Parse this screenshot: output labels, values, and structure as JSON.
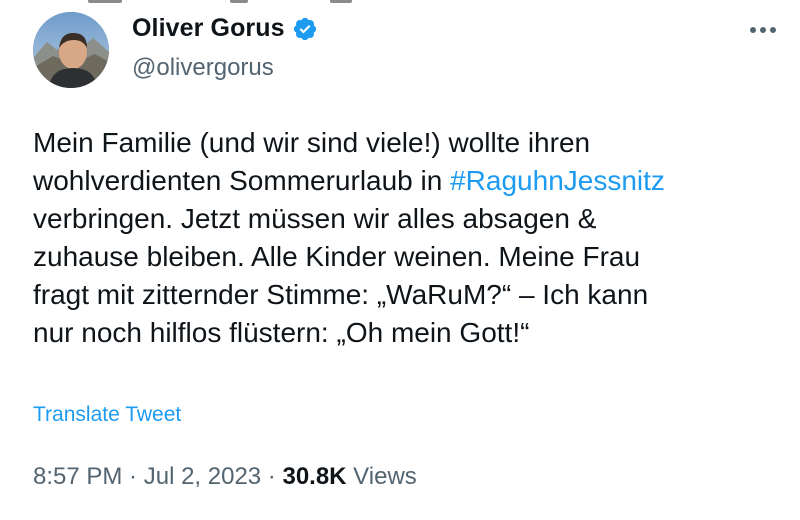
{
  "colors": {
    "text_primary": "#0f1419",
    "text_secondary": "#536471",
    "link_blue": "#1d9bf0",
    "verified_blue": "#1d9bf0"
  },
  "author": {
    "display_name": "Oliver Gorus",
    "handle": "@olivergorus",
    "verified": true,
    "avatar_icon": "profile-photo",
    "verified_icon": "verified-badge-icon"
  },
  "more_menu_icon": "more-options-icon",
  "tweet": {
    "text_before_hashtag": "Mein Familie (und wir sind viele!) wollte ihren\nwohlverdienten Sommerurlaub in ",
    "hashtag": "#RaguhnJessnitz",
    "text_after_hashtag": "\nverbringen. Jetzt müssen wir alles absagen &\nzuhause bleiben. Alle Kinder weinen. Meine Frau\nfragt mit zitternder Stimme: „WaRuM?“ – Ich kann\nnur noch hilflos flüstern: „Oh mein Gott!“"
  },
  "translate_label": "Translate Tweet",
  "meta": {
    "time": "8:57 PM",
    "separator": " · ",
    "date": "Jul 2, 2023",
    "views_count": "30.8K",
    "views_label": " Views"
  }
}
